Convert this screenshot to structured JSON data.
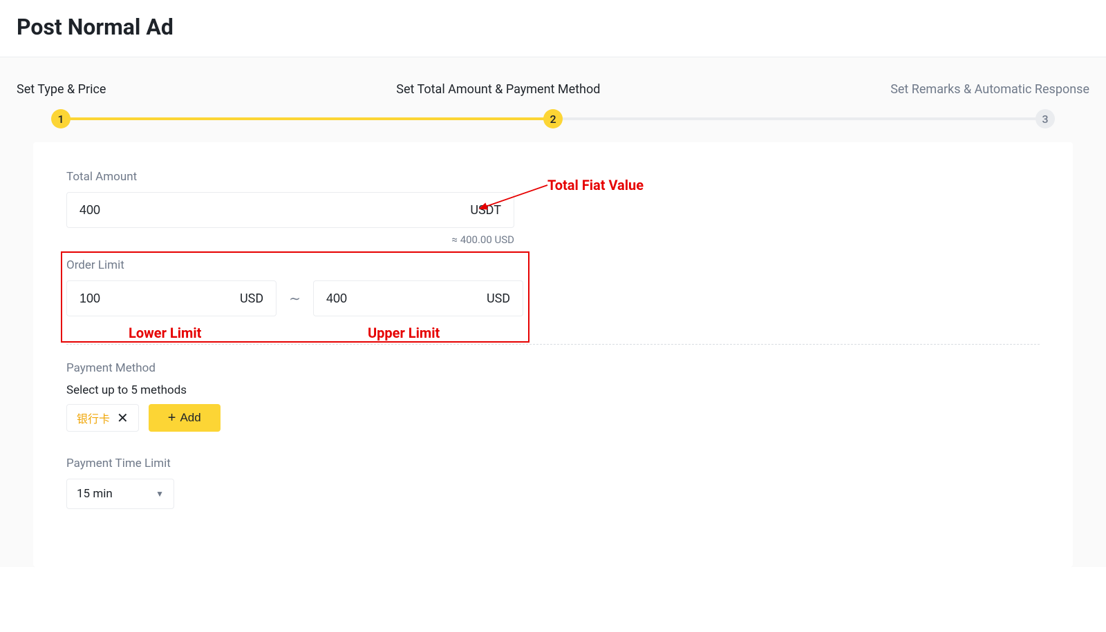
{
  "page_title": "Post Normal Ad",
  "steps": {
    "step1_label": "Set Type & Price",
    "step2_label": "Set Total Amount & Payment Method",
    "step3_label": "Set Remarks & Automatic Response",
    "step1_num": "1",
    "step2_num": "2",
    "step3_num": "3"
  },
  "total": {
    "label": "Total Amount",
    "value": "400",
    "currency": "USDT",
    "approx": "≈ 400.00 USD"
  },
  "order_limit": {
    "label": "Order Limit",
    "lower_value": "100",
    "lower_currency": "USD",
    "separator": "∼",
    "upper_value": "400",
    "upper_currency": "USD"
  },
  "payment": {
    "label": "Payment Method",
    "sublabel": "Select up to 5 methods",
    "chip_name": "银行卡",
    "add_label": "Add"
  },
  "time_limit": {
    "label": "Payment Time Limit",
    "selected": "15 min"
  },
  "annotations": {
    "total_fiat": "Total Fiat Value",
    "lower": "Lower Limit",
    "upper": "Upper Limit"
  }
}
